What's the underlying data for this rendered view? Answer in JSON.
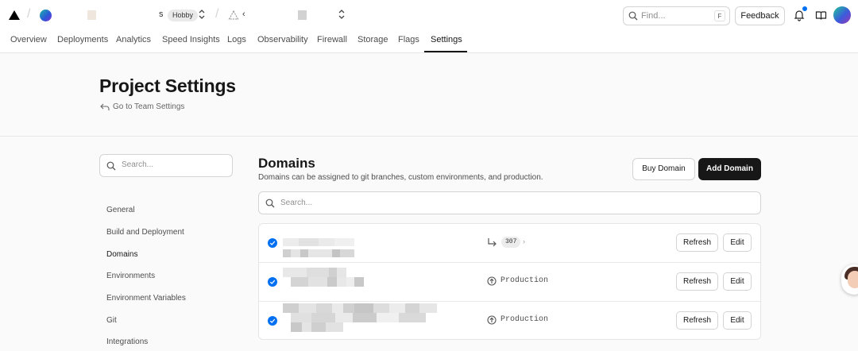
{
  "topbar": {
    "team_tail": "s",
    "plan_badge": "Hobby",
    "project_tail": "‹",
    "find_placeholder": "Find...",
    "find_shortcut": "F",
    "feedback_label": "Feedback"
  },
  "tabs": [
    {
      "label": "Overview"
    },
    {
      "label": "Deployments"
    },
    {
      "label": "Analytics"
    },
    {
      "label": "Speed Insights"
    },
    {
      "label": "Logs"
    },
    {
      "label": "Observability"
    },
    {
      "label": "Firewall"
    },
    {
      "label": "Storage"
    },
    {
      "label": "Flags"
    },
    {
      "label": "Settings",
      "active": true
    }
  ],
  "header": {
    "title": "Project Settings",
    "back_link": "Go to Team Settings"
  },
  "sidebar": {
    "search_placeholder": "Search...",
    "items": [
      {
        "label": "General"
      },
      {
        "label": "Build and Deployment"
      },
      {
        "label": "Domains",
        "active": true
      },
      {
        "label": "Environments"
      },
      {
        "label": "Environment Variables"
      },
      {
        "label": "Git"
      },
      {
        "label": "Integrations"
      }
    ]
  },
  "domains": {
    "title": "Domains",
    "subtitle": "Domains can be assigned to git branches, custom environments, and production.",
    "buy_label": "Buy Domain",
    "add_label": "Add Domain",
    "search_placeholder": "Search...",
    "rows": [
      {
        "target_type": "redirect",
        "status_code": "307",
        "target_tail": "›",
        "refresh_label": "Refresh",
        "edit_label": "Edit"
      },
      {
        "target_type": "environment",
        "environment": "Production",
        "refresh_label": "Refresh",
        "edit_label": "Edit"
      },
      {
        "target_type": "environment",
        "environment": "Production",
        "refresh_label": "Refresh",
        "edit_label": "Edit"
      }
    ]
  },
  "colors": {
    "accent_blue": "#0070f3",
    "primary_button": "#171717",
    "border": "#d4d4d4"
  },
  "icons": [
    "vercel-logo-icon",
    "chevron-updown-icon",
    "search-icon",
    "bell-icon",
    "book-icon",
    "check-circle-icon",
    "redirect-arrow-icon",
    "arrow-up-circle-icon",
    "back-arrow-icon"
  ]
}
